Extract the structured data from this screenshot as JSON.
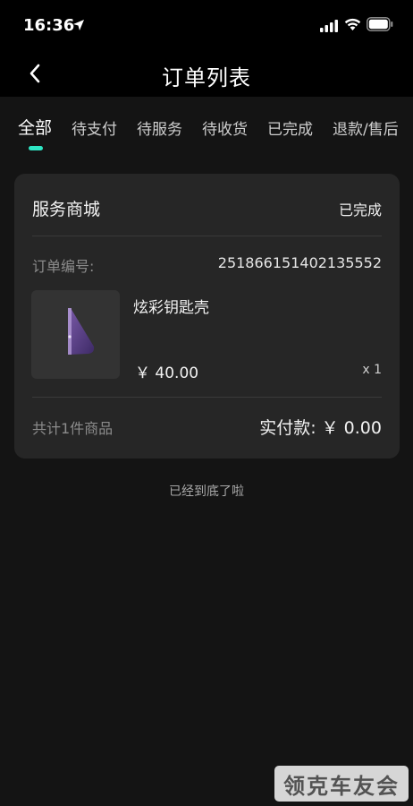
{
  "status_bar": {
    "time": "16:36",
    "icons": [
      "location-arrow-icon",
      "signal-icon",
      "wifi-icon",
      "battery-icon"
    ]
  },
  "header": {
    "title": "订单列表",
    "back_icon": "chevron-left-icon"
  },
  "tabs": [
    {
      "label": "全部",
      "active": true
    },
    {
      "label": "待支付",
      "active": false
    },
    {
      "label": "待服务",
      "active": false
    },
    {
      "label": "待收货",
      "active": false
    },
    {
      "label": "已完成",
      "active": false
    },
    {
      "label": "退款/售后",
      "active": false
    }
  ],
  "colors": {
    "accent": "#2ee6c4",
    "background": "#141414",
    "card": "#262626"
  },
  "order": {
    "shop_name": "服务商城",
    "status": "已完成",
    "order_no_label": "订单编号:",
    "order_no": "251866151402135552",
    "product": {
      "name": "炫彩钥匙壳",
      "price": "￥ 40.00",
      "quantity": "x 1"
    },
    "total_count": "共计1件商品",
    "paid_label": "实付款:",
    "paid_value": "￥ 0.00"
  },
  "footer": {
    "end_text": "已经到底了啦"
  },
  "watermark": {
    "text": "领克车友会"
  }
}
